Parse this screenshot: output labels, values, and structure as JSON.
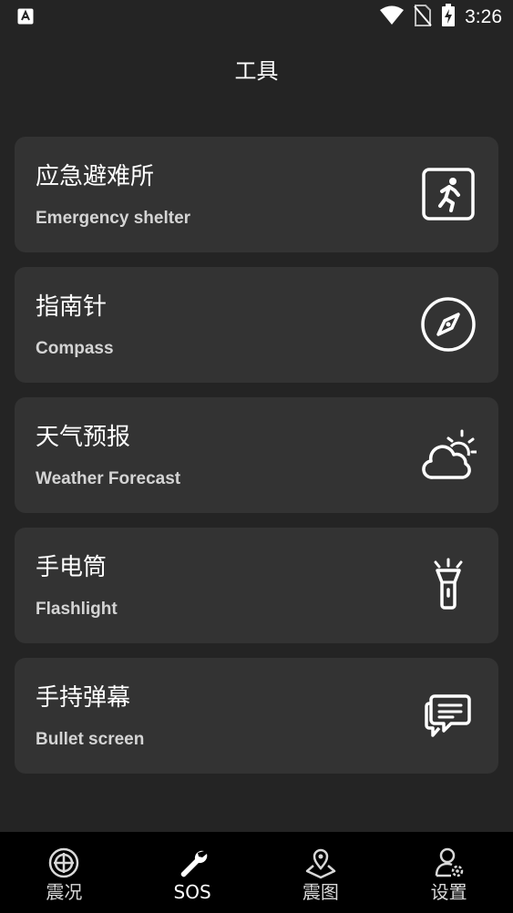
{
  "status_bar": {
    "time": "3:26",
    "icons": [
      "font-app-icon",
      "wifi-icon",
      "no-sim-icon",
      "battery-charging-icon"
    ]
  },
  "header": {
    "title": "工具"
  },
  "tools": [
    {
      "title": "应急避难所",
      "subtitle": "Emergency shelter",
      "icon": "emergency-exit-icon"
    },
    {
      "title": "指南针",
      "subtitle": "Compass",
      "icon": "compass-icon"
    },
    {
      "title": "天气预报",
      "subtitle": "Weather Forecast",
      "icon": "weather-icon"
    },
    {
      "title": "手电筒",
      "subtitle": "Flashlight",
      "icon": "flashlight-icon"
    },
    {
      "title": "手持弹幕",
      "subtitle": "Bullet screen",
      "icon": "chat-bubble-icon"
    }
  ],
  "tabs": [
    {
      "label": "震况",
      "icon": "target-icon",
      "active": false
    },
    {
      "label": "SOS",
      "icon": "wrench-icon",
      "active": true
    },
    {
      "label": "震图",
      "icon": "map-pin-icon",
      "active": false
    },
    {
      "label": "设置",
      "icon": "user-settings-icon",
      "active": false
    }
  ],
  "colors": {
    "background": "#242424",
    "card": "#333333",
    "tabbar": "#000000",
    "text": "#ffffff",
    "subtext": "#d4d4d4"
  }
}
